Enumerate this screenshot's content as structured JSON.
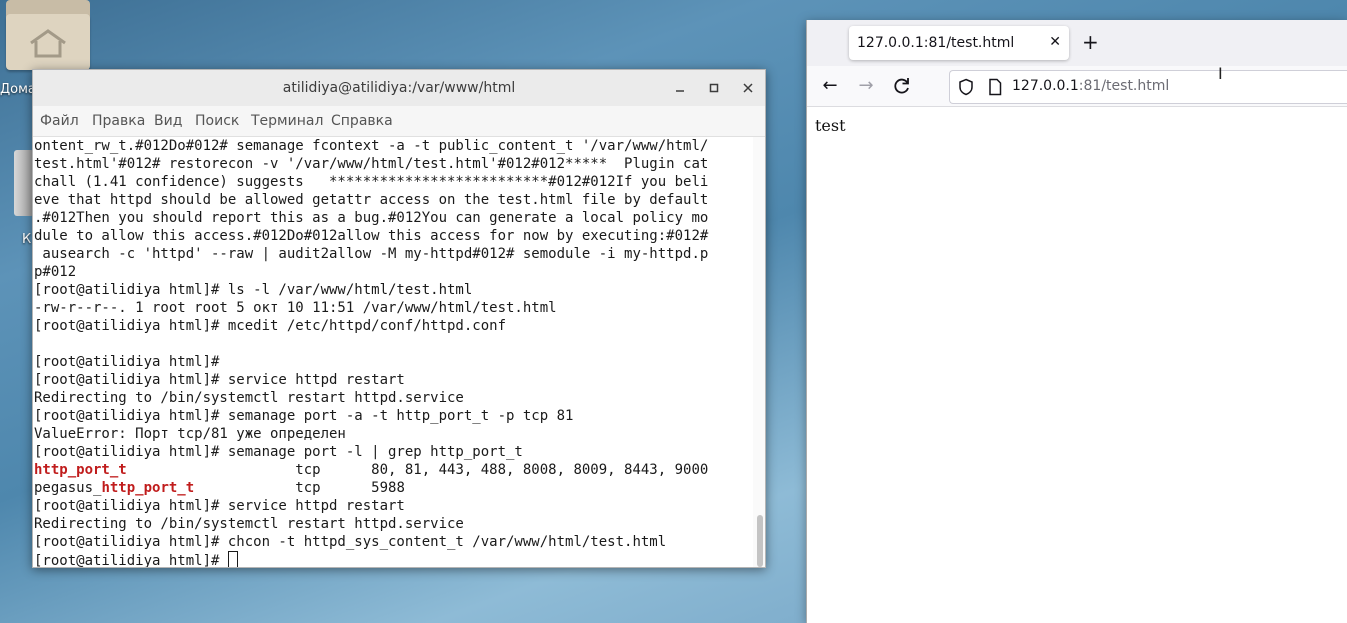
{
  "desktop": {
    "home_label": "Домашняя папка",
    "home_label_visible": "Домаш",
    "trash_label_visible": "К"
  },
  "terminal": {
    "title": "atilidiya@atilidiya:/var/www/html",
    "menu": [
      "Файл",
      "Правка",
      "Вид",
      "Поиск",
      "Терминал",
      "Справка"
    ],
    "lines": [
      {
        "segments": [
          {
            "text": "ontent_rw_t.#012Do#012# semanage fcontext -a -t public_content_t '/var/www/html/",
            "hl": false
          }
        ]
      },
      {
        "segments": [
          {
            "text": "test.html'#012# restorecon -v '/var/www/html/test.html'#012#012*****  Plugin cat",
            "hl": false
          }
        ]
      },
      {
        "segments": [
          {
            "text": "chall (1.41 confidence) suggests   **************************#012#012If you beli",
            "hl": false
          }
        ]
      },
      {
        "segments": [
          {
            "text": "eve that httpd should be allowed getattr access on the test.html file by default",
            "hl": false
          }
        ]
      },
      {
        "segments": [
          {
            "text": ".#012Then you should report this as a bug.#012You can generate a local policy mo",
            "hl": false
          }
        ]
      },
      {
        "segments": [
          {
            "text": "dule to allow this access.#012Do#012allow this access for now by executing:#012#",
            "hl": false
          }
        ]
      },
      {
        "segments": [
          {
            "text": " ausearch -c 'httpd' --raw | audit2allow -M my-httpd#012# semodule -i my-httpd.p",
            "hl": false
          }
        ]
      },
      {
        "segments": [
          {
            "text": "p#012",
            "hl": false
          }
        ]
      },
      {
        "segments": [
          {
            "text": "[root@atilidiya html]# ls -l /var/www/html/test.html",
            "hl": false
          }
        ]
      },
      {
        "segments": [
          {
            "text": "-rw-r--r--. 1 root root 5 окт 10 11:51 /var/www/html/test.html",
            "hl": false
          }
        ]
      },
      {
        "segments": [
          {
            "text": "[root@atilidiya html]# mcedit /etc/httpd/conf/httpd.conf",
            "hl": false
          }
        ]
      },
      {
        "segments": [
          {
            "text": "",
            "hl": false
          }
        ]
      },
      {
        "segments": [
          {
            "text": "[root@atilidiya html]#",
            "hl": false
          }
        ]
      },
      {
        "segments": [
          {
            "text": "[root@atilidiya html]# service httpd restart",
            "hl": false
          }
        ]
      },
      {
        "segments": [
          {
            "text": "Redirecting to /bin/systemctl restart httpd.service",
            "hl": false
          }
        ]
      },
      {
        "segments": [
          {
            "text": "[root@atilidiya html]# semanage port -a -t http_port_t -p tcp 81",
            "hl": false
          }
        ]
      },
      {
        "segments": [
          {
            "text": "ValueError: Порт tcp/81 уже определен",
            "hl": false
          }
        ]
      },
      {
        "segments": [
          {
            "text": "[root@atilidiya html]# semanage port -l | grep http_port_t",
            "hl": false
          }
        ]
      },
      {
        "segments": [
          {
            "text": "http_port_t",
            "hl": true
          },
          {
            "text": "                    tcp      80, 81, 443, 488, 8008, 8009, 8443, 9000",
            "hl": false
          }
        ]
      },
      {
        "segments": [
          {
            "text": "pegasus_",
            "hl": false
          },
          {
            "text": "http_port_t",
            "hl": true
          },
          {
            "text": "            tcp      5988",
            "hl": false
          }
        ]
      },
      {
        "segments": [
          {
            "text": "[root@atilidiya html]# service httpd restart",
            "hl": false
          }
        ]
      },
      {
        "segments": [
          {
            "text": "Redirecting to /bin/systemctl restart httpd.service",
            "hl": false
          }
        ]
      },
      {
        "segments": [
          {
            "text": "[root@atilidiya html]# chcon -t httpd_sys_content_t /var/www/html/test.html",
            "hl": false
          }
        ]
      },
      {
        "segments": [
          {
            "text": "[root@atilidiya html]# ",
            "hl": false
          }
        ],
        "cursor": true
      }
    ]
  },
  "browser": {
    "tab_title": "127.0.0.1:81/test.html",
    "url_host": "127.0.0.1",
    "url_rest": ":81/test.html",
    "page_text": "test"
  }
}
